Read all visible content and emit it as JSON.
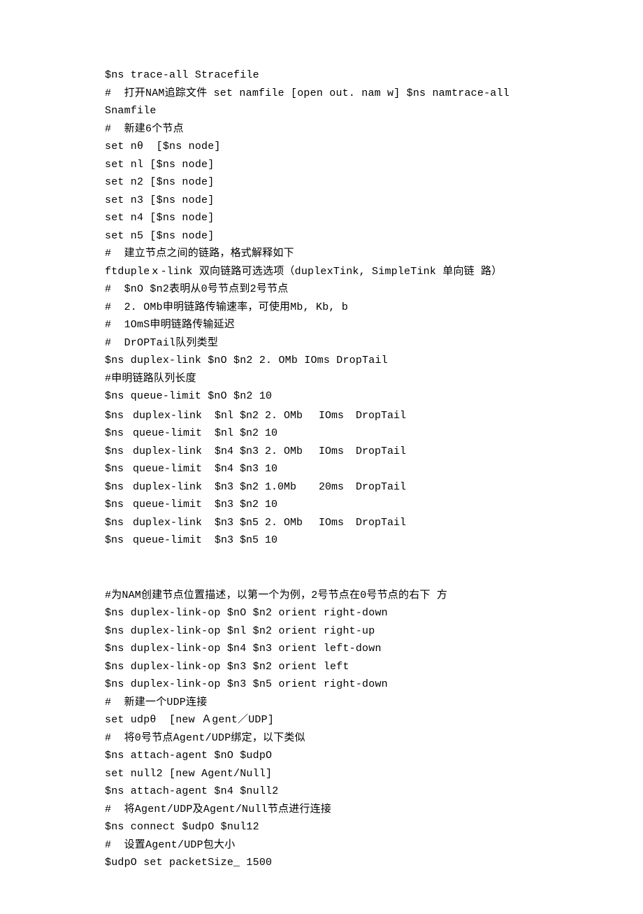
{
  "lines_a": [
    "$ns trace-all Stracefile",
    "#  打开NAM追踪文件 set namfile [open out. nam w] $ns namtrace-all",
    "Snamfile",
    "#  新建6个节点",
    "set nθ  [$ns node]",
    "set nl [$ns node]",
    "set n2 [$ns node]",
    "set n3 [$ns node]",
    "set n4 [$ns node]",
    "set n5 [$ns node]",
    "#  建立节点之间的链路，格式解释如下",
    "ftdupleｘ-link 双向链路可选选项（duplexTink, SimpleTink 单向链 路）",
    "#  $nO $n2表明从0号节点到2号节点",
    "#  2. OMb申明链路传输速率，可使用Mb, Kb, b",
    "#  1OmS申明链路传输延迟",
    "#  DrOPTail队列类型",
    "$ns duplex-link $nO $n2 2. OMb IOms DropTail",
    "#申明链路队列长度",
    "$ns queue-limit $nO $n2 10"
  ],
  "table_rows": [
    {
      "c1": "$ns",
      "c2": "duplex-link",
      "c3": " $nl $n2 2. OMb",
      "c4": "IOms",
      "c5": " DropTail"
    },
    {
      "c1": "$ns",
      "c2": "queue-limit",
      "c3": " $nl $n2 10",
      "c4": "",
      "c5": ""
    },
    {
      "c1": "$ns",
      "c2": "duplex-link",
      "c3": " $n4 $n3 2. OMb",
      "c4": "IOms",
      "c5": " DropTail"
    },
    {
      "c1": "$ns",
      "c2": "queue-limit",
      "c3": " $n4 $n3 10",
      "c4": "",
      "c5": ""
    },
    {
      "c1": "$ns",
      "c2": "duplex-link",
      "c3": " $n3 $n2 1.0Mb ",
      "c4": "20ms",
      "c5": " DropTail"
    },
    {
      "c1": "$ns",
      "c2": "queue-limit",
      "c3": " $n3 $n2 10",
      "c4": "",
      "c5": ""
    },
    {
      "c1": "$ns",
      "c2": "duplex-link",
      "c3": " $n3 $n5 2. OMb",
      "c4": "IOms",
      "c5": " DropTail"
    },
    {
      "c1": "$ns",
      "c2": "queue-limit",
      "c3": " $n3 $n5 10",
      "c4": "",
      "c5": ""
    }
  ],
  "lines_b": [
    "",
    "",
    "#为NAM创建节点位置描述，以第一个为例，2号节点在0号节点的右下 方",
    "$ns duplex-link-op $nO $n2 orient right-down",
    "$ns duplex-link-op $nl $n2 orient right-up",
    "$ns duplex-link-op $n4 $n3 orient left-down",
    "$ns duplex-link-op $n3 $n2 orient left",
    "$ns duplex-link-op $n3 $n5 orient right-down",
    "#  新建一个UDP连接",
    "set udpθ  [new Ａgent／UDP]",
    "#  将0号节点Agent/UDP绑定，以下类似",
    "$ns attach-agent $nO $udpO",
    "set null2 [new Agent/Null]",
    "$ns attach-agent $n4 $null2",
    "#  将Agent/UDP及Agent/Null节点进行连接",
    "$ns connect $udpO $nul12",
    "#  设置Agent/UDP包大小",
    "$udpO set packetSize_ 1500"
  ]
}
